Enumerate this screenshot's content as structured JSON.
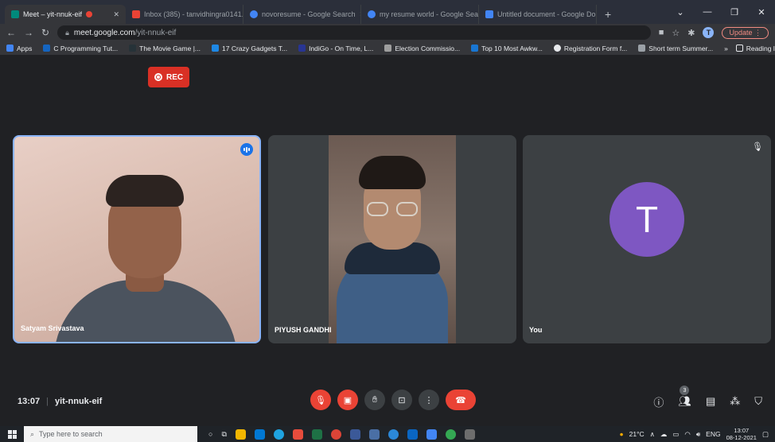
{
  "browser": {
    "tabs": [
      {
        "label": "Meet – yit-nnuk-eif",
        "active": true,
        "color": "#00897b"
      },
      {
        "label": "Inbox (385) - tanvidhingra0141...",
        "active": false,
        "color": "#ea4335"
      },
      {
        "label": "novoresume - Google Search",
        "active": false,
        "color": "#4285f4"
      },
      {
        "label": "my resume world - Google Sear...",
        "active": false,
        "color": "#4285f4"
      },
      {
        "label": "Untitled document - Google Do...",
        "active": false,
        "color": "#4285f4"
      }
    ],
    "url_domain": "meet.google.com",
    "url_path": "/yit-nnuk-eif",
    "profile_initial": "T",
    "update_label": "Update",
    "bookmarks": [
      "Apps",
      "C Programming Tut...",
      "The Movie Game |...",
      "17 Crazy Gadgets T...",
      "IndiGo - On Time, L...",
      "Election Commissio...",
      "Top 10 Most Awkw...",
      "Registration Form f...",
      "Short term Summer..."
    ],
    "reading_list": "Reading list"
  },
  "meet": {
    "rec_label": "REC",
    "participants": [
      {
        "name": "Satyam Srivastava"
      },
      {
        "name": "PIYUSH GANDHI"
      },
      {
        "name": "You",
        "initial": "T"
      }
    ],
    "time": "13:07",
    "meeting_code": "yit-nnuk-eif",
    "people_count": "3"
  },
  "taskbar": {
    "search_placeholder": "Type here to search",
    "weather": "21°C",
    "language": "ENG",
    "clock_time": "13:07",
    "clock_date": "08-12-2021"
  }
}
